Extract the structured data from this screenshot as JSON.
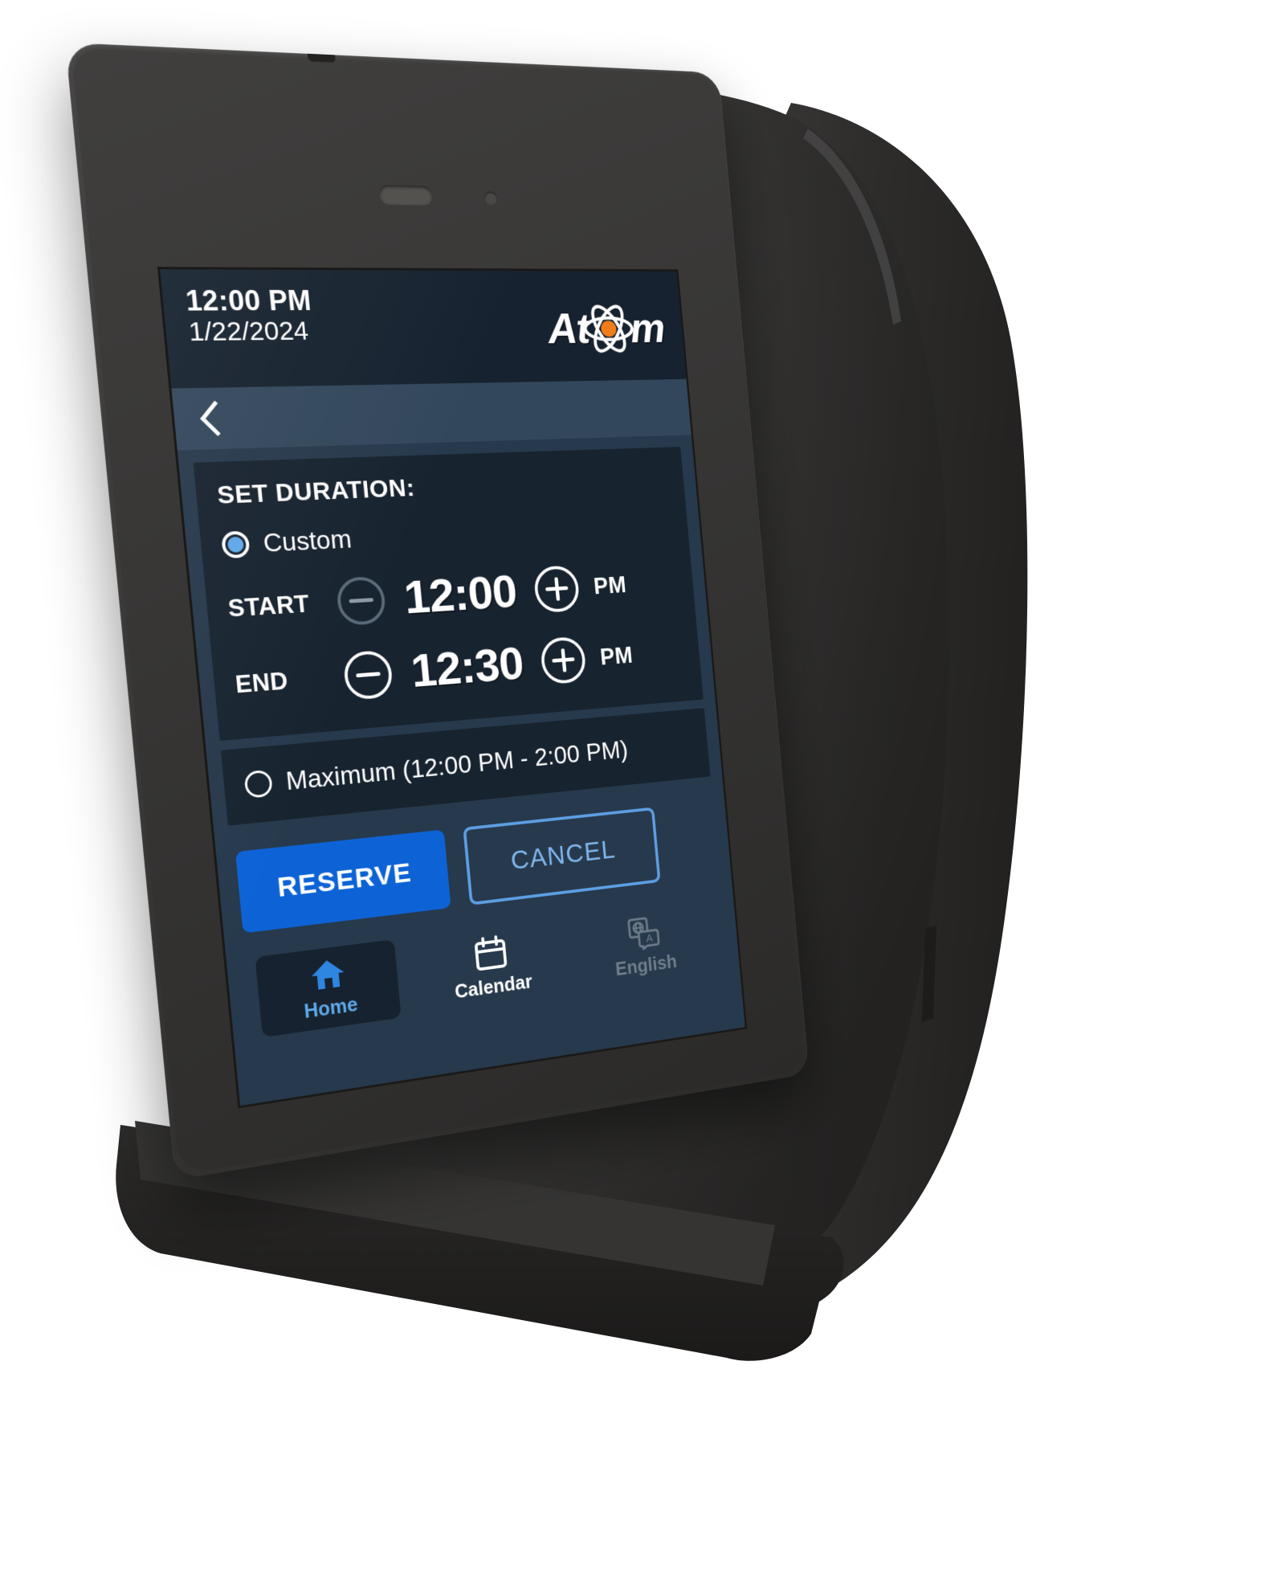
{
  "device": {
    "name": "atom-room-booking-panel",
    "body_color": "#2f2e2d"
  },
  "screen": {
    "header": {
      "time": "12:00 PM",
      "date": "1/22/2024",
      "logo_text_left": "At",
      "logo_text_right": "m",
      "logo_name": "atom-logo",
      "logo_nucleus_color": "#f07d1a",
      "background": "#16222f"
    },
    "back_bar": {
      "back_icon": "chevron-left-icon",
      "background": "#33475c"
    },
    "duration_card": {
      "title": "SET DURATION:",
      "custom_option": {
        "label": "Custom",
        "selected": true,
        "accent": "#5fa8e8"
      },
      "rows": [
        {
          "label": "START",
          "value": "12:00",
          "ampm": "PM",
          "minus_enabled": false,
          "plus_enabled": true,
          "minus_icon": "minus-circle-icon",
          "plus_icon": "plus-circle-icon"
        },
        {
          "label": "END",
          "value": "12:30",
          "ampm": "PM",
          "minus_enabled": true,
          "plus_enabled": true,
          "minus_icon": "minus-circle-icon",
          "plus_icon": "plus-circle-icon"
        }
      ]
    },
    "maximum_card": {
      "label": "Maximum (12:00 PM - 2:00 PM)",
      "selected": false
    },
    "actions": {
      "reserve_label": "RESERVE",
      "reserve_color": "#0d63d6",
      "cancel_label": "CANCEL",
      "cancel_color": "#5d9fe4"
    },
    "nav": [
      {
        "label": "Home",
        "icon": "home-icon",
        "state": "active"
      },
      {
        "label": "Calendar",
        "icon": "calendar-icon",
        "state": "plain"
      },
      {
        "label": "English",
        "icon": "translate-icon",
        "state": "dim"
      }
    ]
  }
}
